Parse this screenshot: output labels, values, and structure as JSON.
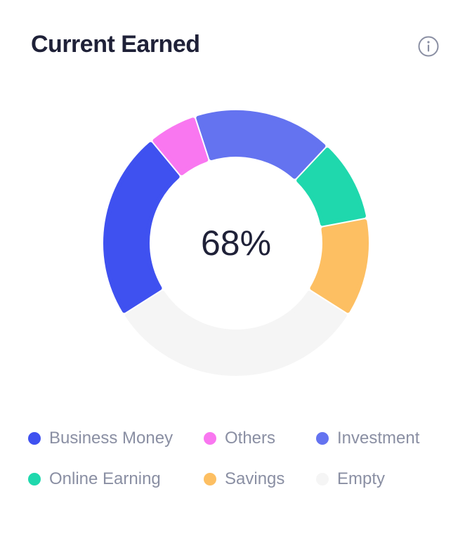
{
  "card": {
    "title": "Current Earned",
    "info_icon": "info-circle-icon"
  },
  "chart_data": {
    "type": "pie",
    "title": "Current Earned",
    "center_label": "68%",
    "slices": [
      {
        "name": "Business Money",
        "value": 23,
        "color": "#3f51f0"
      },
      {
        "name": "Others",
        "value": 6,
        "color": "#f977f0"
      },
      {
        "name": "Investment",
        "value": 17,
        "color": "#6473f0"
      },
      {
        "name": "Online Earning",
        "value": 10,
        "color": "#1fd8ad"
      },
      {
        "name": "Savings",
        "value": 12,
        "color": "#fdbf62"
      },
      {
        "name": "Empty",
        "value": 32,
        "color": "#f5f5f5"
      }
    ],
    "legend_placement": "bottom"
  },
  "legend": {
    "items": [
      {
        "label": "Business Money",
        "color": "#3f51f0"
      },
      {
        "label": "Others",
        "color": "#f977f0"
      },
      {
        "label": "Investment",
        "color": "#6473f0"
      },
      {
        "label": "Online Earning",
        "color": "#1fd8ad"
      },
      {
        "label": "Savings",
        "color": "#fdbf62"
      },
      {
        "label": "Empty",
        "color": "#f5f5f5"
      }
    ]
  }
}
